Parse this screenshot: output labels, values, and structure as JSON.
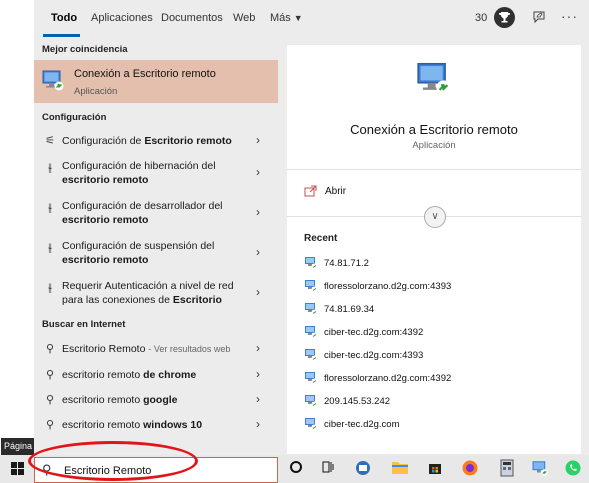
{
  "sidebar_label": "Página",
  "tabs": [
    {
      "label": "Todo"
    },
    {
      "label": "Aplicaciones"
    },
    {
      "label": "Documentos"
    },
    {
      "label": "Web"
    },
    {
      "label": "Más"
    }
  ],
  "header": {
    "points": "30",
    "trophy_icon": "trophy-icon",
    "feedback_icon": "feedback-icon",
    "more_label": "···"
  },
  "best_match": {
    "section": "Mejor coincidencia",
    "title": "Conexión a Escritorio remoto",
    "subtitle": "Aplicación"
  },
  "config": {
    "section": "Configuración",
    "items": [
      {
        "text": "Configuración de Escritorio remoto",
        "icon": "sliders-icon"
      },
      {
        "text": "Configuración de hibernación del escritorio remoto",
        "icon": "settings-icon"
      },
      {
        "text": "Configuración de desarrollador del escritorio remoto",
        "icon": "settings-icon"
      },
      {
        "text": "Configuración de suspensión del escritorio remoto",
        "icon": "settings-icon"
      },
      {
        "text": "Requerir Autenticación a nivel de red para las conexiones de Escritorio",
        "icon": "settings-icon"
      }
    ]
  },
  "web": {
    "section": "Buscar en Internet",
    "items": [
      {
        "text": "Escritorio Remoto",
        "sub": "- Ver resultados web"
      },
      {
        "text": "escritorio remoto de chrome"
      },
      {
        "text": "escritorio remoto google"
      },
      {
        "text": "escritorio remoto windows 10"
      }
    ]
  },
  "preview": {
    "title": "Conexión a Escritorio remoto",
    "subtitle": "Aplicación",
    "open_label": "Abrir",
    "recent_heading": "Recent",
    "recent": [
      "74.81.71.2",
      "floressolorzano.d2g.com:4393",
      "74.81.69.34",
      "ciber-tec.d2g.com:4392",
      "ciber-tec.d2g.com:4393",
      "floressolorzano.d2g.com:4392",
      "209.145.53.242",
      "ciber-tec.d2g.com"
    ]
  },
  "search": {
    "value": "Escritorio Remoto"
  },
  "taskbar": {
    "icons": [
      "cortana-icon",
      "task-view-icon",
      "app-icon",
      "file-explorer-icon",
      "store-icon",
      "firefox-icon",
      "calculator-icon",
      "remote-desktop-icon",
      "whatsapp-icon"
    ]
  },
  "colors": {
    "accent": "#0063b1",
    "highlight": "#e4bfae",
    "annotation": "#e2141a"
  }
}
